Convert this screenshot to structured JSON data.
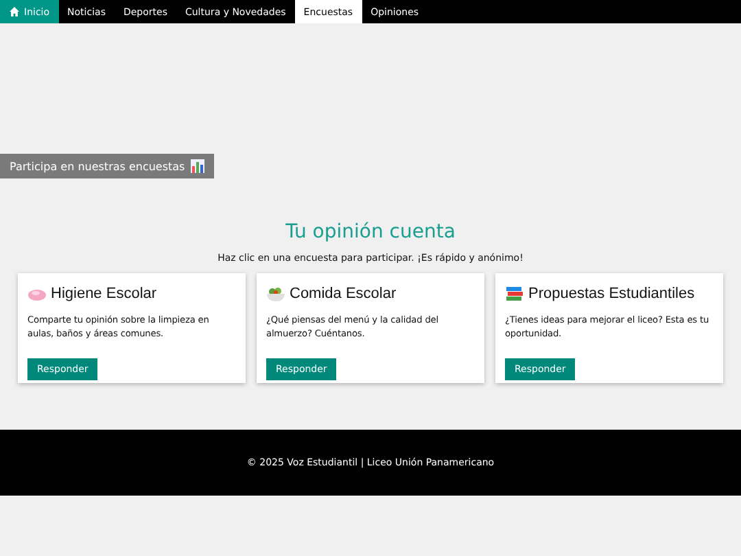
{
  "nav": [
    {
      "label": "Inicio",
      "selected": false,
      "kind": "home"
    },
    {
      "label": "Noticias",
      "selected": false,
      "kind": "link"
    },
    {
      "label": "Deportes",
      "selected": false,
      "kind": "link"
    },
    {
      "label": "Cultura y Novedades",
      "selected": false,
      "kind": "link"
    },
    {
      "label": "Encuestas",
      "selected": true,
      "kind": "link"
    },
    {
      "label": "Opiniones",
      "selected": false,
      "kind": "link"
    }
  ],
  "banner_button": "Participa en nuestras encuestas",
  "heading": "Tu opinión cuenta",
  "intro": "Haz clic en una encuesta para participar. ¡Es rápido y anónimo!",
  "cards": [
    {
      "kind": "soap",
      "title": "Higiene Escolar",
      "text": "Comparte tu opinión sobre la limpieza en aulas, baños y áreas comunes.",
      "button": "Responder"
    },
    {
      "kind": "bowl",
      "title": "Comida Escolar",
      "text": "¿Qué piensas del menú y la calidad del almuerzo? Cuéntanos.",
      "button": "Responder"
    },
    {
      "kind": "books",
      "title": "Propuestas Estudiantiles",
      "text": "¿Tienes ideas para mejorar el liceo? Esta es tu oportunidad.",
      "button": "Responder"
    }
  ],
  "footer": "© 2025 Voz Estudiantil | Liceo Unión Panamericano"
}
